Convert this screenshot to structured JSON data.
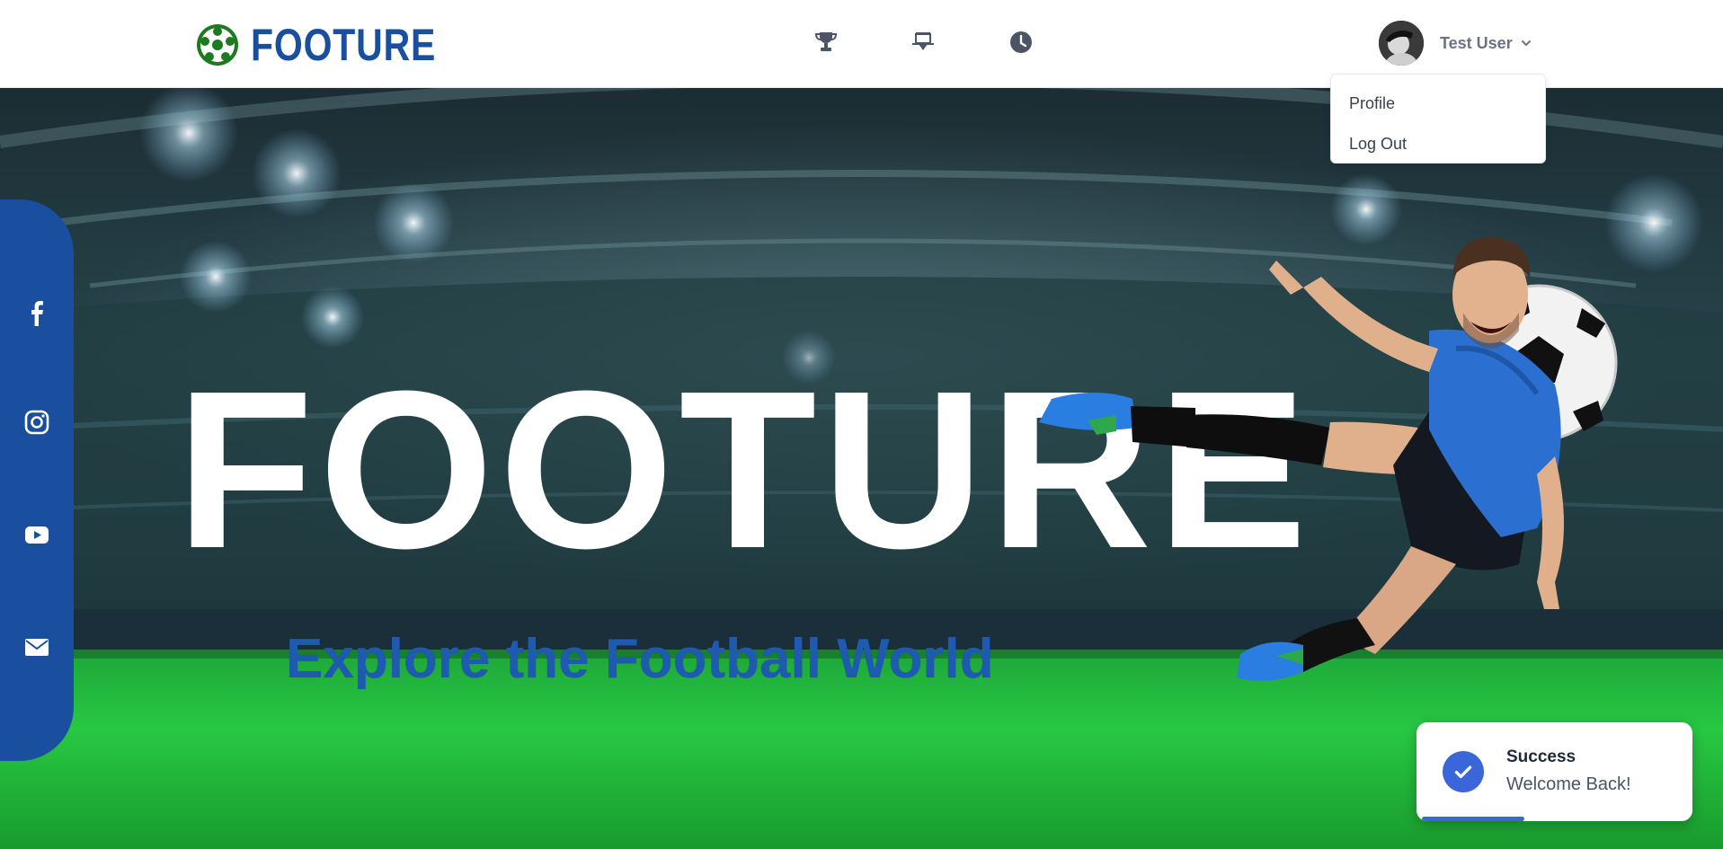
{
  "brand": {
    "name": "FOOTURE",
    "logo_icon": "soccer-ball-icon",
    "color": "#1a4fa0",
    "ball_color": "#1e7a1e"
  },
  "nav": {
    "icons": [
      {
        "name": "trophy-icon"
      },
      {
        "name": "stadium-icon"
      },
      {
        "name": "clock-icon"
      }
    ]
  },
  "user": {
    "name": "Test User",
    "dropdown_icon": "chevron-down-icon"
  },
  "dropdown": {
    "items": [
      "Profile",
      "Log Out"
    ]
  },
  "hero": {
    "title": "FOOTURE",
    "subtitle": "Explore the Football World",
    "subtitle_color": "#1e5bb0"
  },
  "social": {
    "color": "#1a4fa0",
    "links": [
      {
        "name": "facebook-icon"
      },
      {
        "name": "instagram-icon"
      },
      {
        "name": "youtube-icon"
      },
      {
        "name": "email-icon"
      }
    ]
  },
  "toast": {
    "title": "Success",
    "message": "Welcome Back!",
    "icon": "check-circle-icon",
    "accent": "#3b66d9",
    "progress": 0.37
  }
}
